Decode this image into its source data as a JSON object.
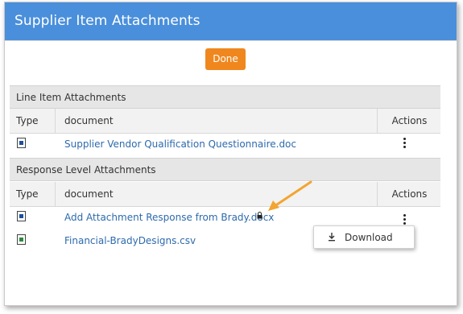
{
  "modal": {
    "title": "Supplier Item Attachments",
    "done_label": "Done"
  },
  "line_items": {
    "section_title": "Line Item Attachments",
    "columns": {
      "type": "Type",
      "document": "document",
      "actions": "Actions"
    },
    "rows": [
      {
        "type_icon": "word-doc-icon",
        "document": "Supplier Vendor Qualification Questionnaire.doc"
      }
    ]
  },
  "response_level": {
    "section_title": "Response Level Attachments",
    "columns": {
      "type": "Type",
      "document": "document",
      "actions": "Actions"
    },
    "rows": [
      {
        "type_icon": "word-doc-icon",
        "document": "Add Attachment Response from Brady.docx",
        "locked": true
      },
      {
        "type_icon": "csv-file-icon",
        "document": "Financial-BradyDesigns.csv"
      }
    ]
  },
  "actions_menu": {
    "items": [
      {
        "icon": "download-icon",
        "label": "Download"
      }
    ]
  },
  "colors": {
    "header": "#4a8fdb",
    "done_button": "#f0871e",
    "link": "#2d6aad",
    "annotation_arrow": "#f2a531"
  }
}
